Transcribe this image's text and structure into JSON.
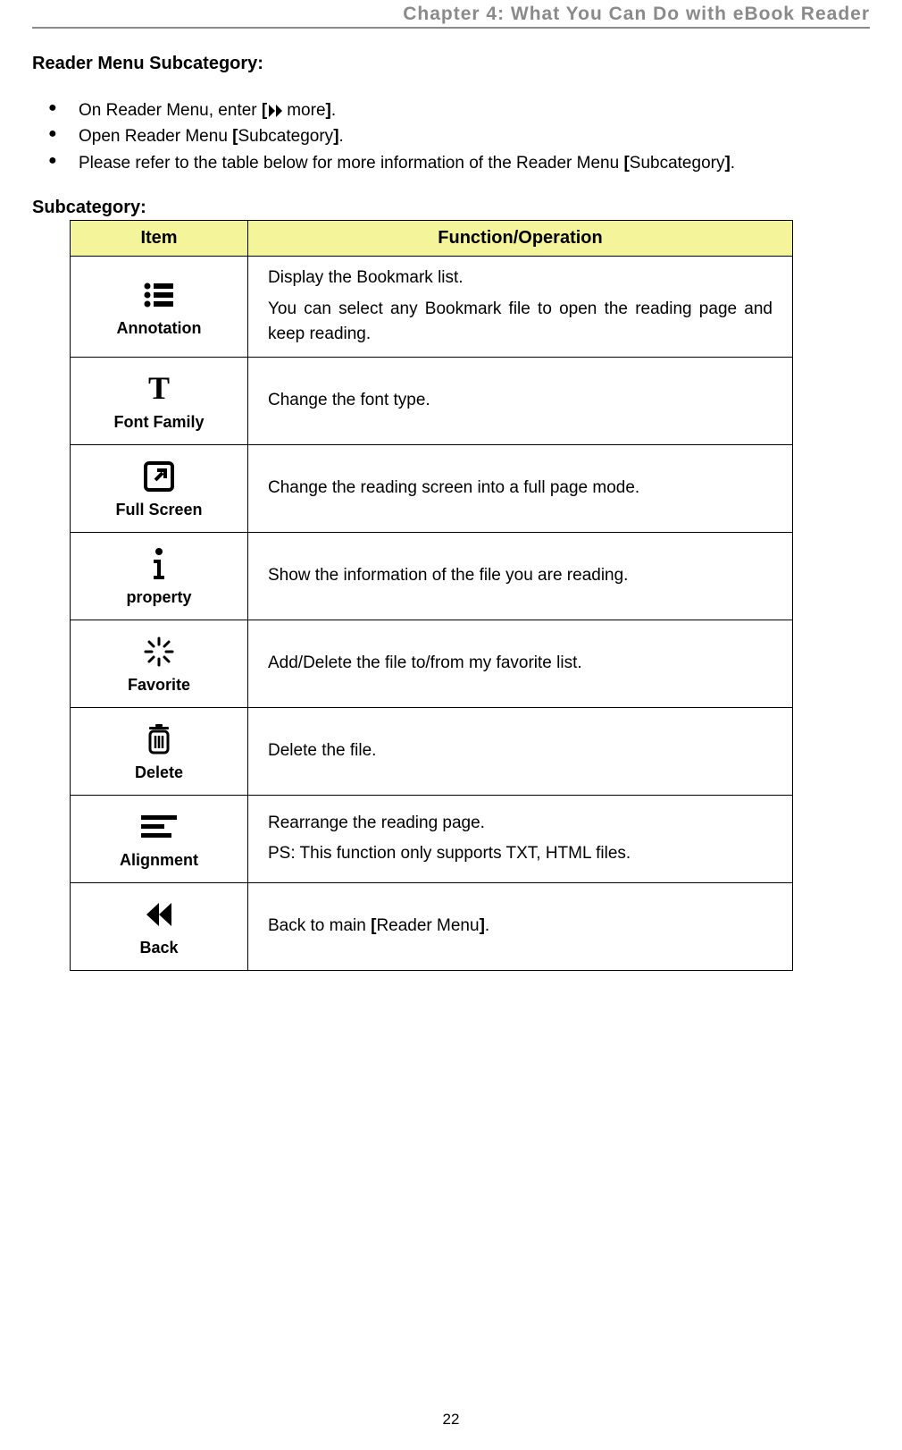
{
  "header": {
    "chapter": "Chapter 4: What You Can Do with eBook Reader"
  },
  "section_title": "Reader Menu Subcategory:",
  "bullets": {
    "b1_pre": "On Reader Menu, enter ",
    "b1_more": "more",
    "b1_post": ".",
    "b2_pre": "Open Reader Menu ",
    "b2_mid": "Subcategory",
    "b2_post": ".",
    "b3_pre": "Please refer to the table below for more information of the Reader Menu ",
    "b3_mid": "Subcategory",
    "b3_post": "."
  },
  "brackets": {
    "open": "[",
    "close": "]"
  },
  "sub_label": "Subcategory:",
  "table": {
    "head_item": "Item",
    "head_func": "Function/Operation",
    "rows": [
      {
        "label": "Annotation",
        "func1": "Display the Bookmark list.",
        "func2": "You can select any Bookmark file to open the reading page and keep reading."
      },
      {
        "label": "Font Family",
        "func1": "Change the font type."
      },
      {
        "label": "Full Screen",
        "func1": "Change the reading screen into a full page mode."
      },
      {
        "label": "property",
        "func1": "Show the information of the file you are reading."
      },
      {
        "label": "Favorite",
        "func1": "Add/Delete the file to/from my favorite list."
      },
      {
        "label": "Delete",
        "func1": "Delete the file."
      },
      {
        "label": "Alignment",
        "func1": "Rearrange the reading page.",
        "func2": "PS: This function only supports TXT, HTML files."
      },
      {
        "label": "Back",
        "func1_pre": "Back to main ",
        "func1_mid": "Reader Menu",
        "func1_post": "."
      }
    ]
  },
  "page_number": "22"
}
